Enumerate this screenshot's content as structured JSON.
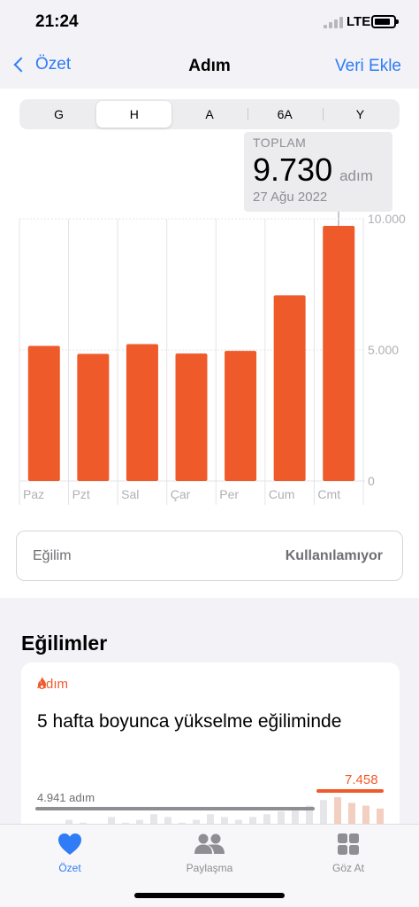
{
  "status": {
    "time": "21:24",
    "network": "LTE"
  },
  "nav": {
    "back_label": "Özet",
    "title": "Adım",
    "action_label": "Veri Ekle"
  },
  "segments": [
    {
      "label": "G",
      "active": false
    },
    {
      "label": "H",
      "active": true
    },
    {
      "label": "A",
      "active": false
    },
    {
      "label": "6A",
      "active": false
    },
    {
      "label": "Y",
      "active": false
    }
  ],
  "tooltip": {
    "label": "TOPLAM",
    "value": "9.730",
    "unit": "adım",
    "date": "27 Ağu 2022"
  },
  "chart_data": {
    "type": "bar",
    "categories": [
      "Paz",
      "Pzt",
      "Sal",
      "Çar",
      "Per",
      "Cum",
      "Cmt"
    ],
    "values": [
      5150,
      4850,
      5220,
      4860,
      4960,
      7080,
      9730
    ],
    "y_ticks": [
      "10.000",
      "5.000",
      "0"
    ],
    "ylim": [
      0,
      10000
    ],
    "color": "#ef5a2b",
    "grid": true,
    "selected_index": 6
  },
  "trend": {
    "label": "Eğilim",
    "value": "Kullanılamıyor"
  },
  "trends_section": {
    "title": "Eğilimler",
    "card": {
      "tag": "Adım",
      "headline": "5 hafta boyunca yükselme eğiliminde",
      "old_value": "4.941 adım",
      "new_value": "7.458",
      "accent": "#f05a2a"
    }
  },
  "tabbar": [
    {
      "label": "Özet",
      "icon": "heart-icon",
      "active": true
    },
    {
      "label": "Paylaşma",
      "icon": "people-icon",
      "active": false
    },
    {
      "label": "Göz At",
      "icon": "grid-icon",
      "active": false
    }
  ]
}
